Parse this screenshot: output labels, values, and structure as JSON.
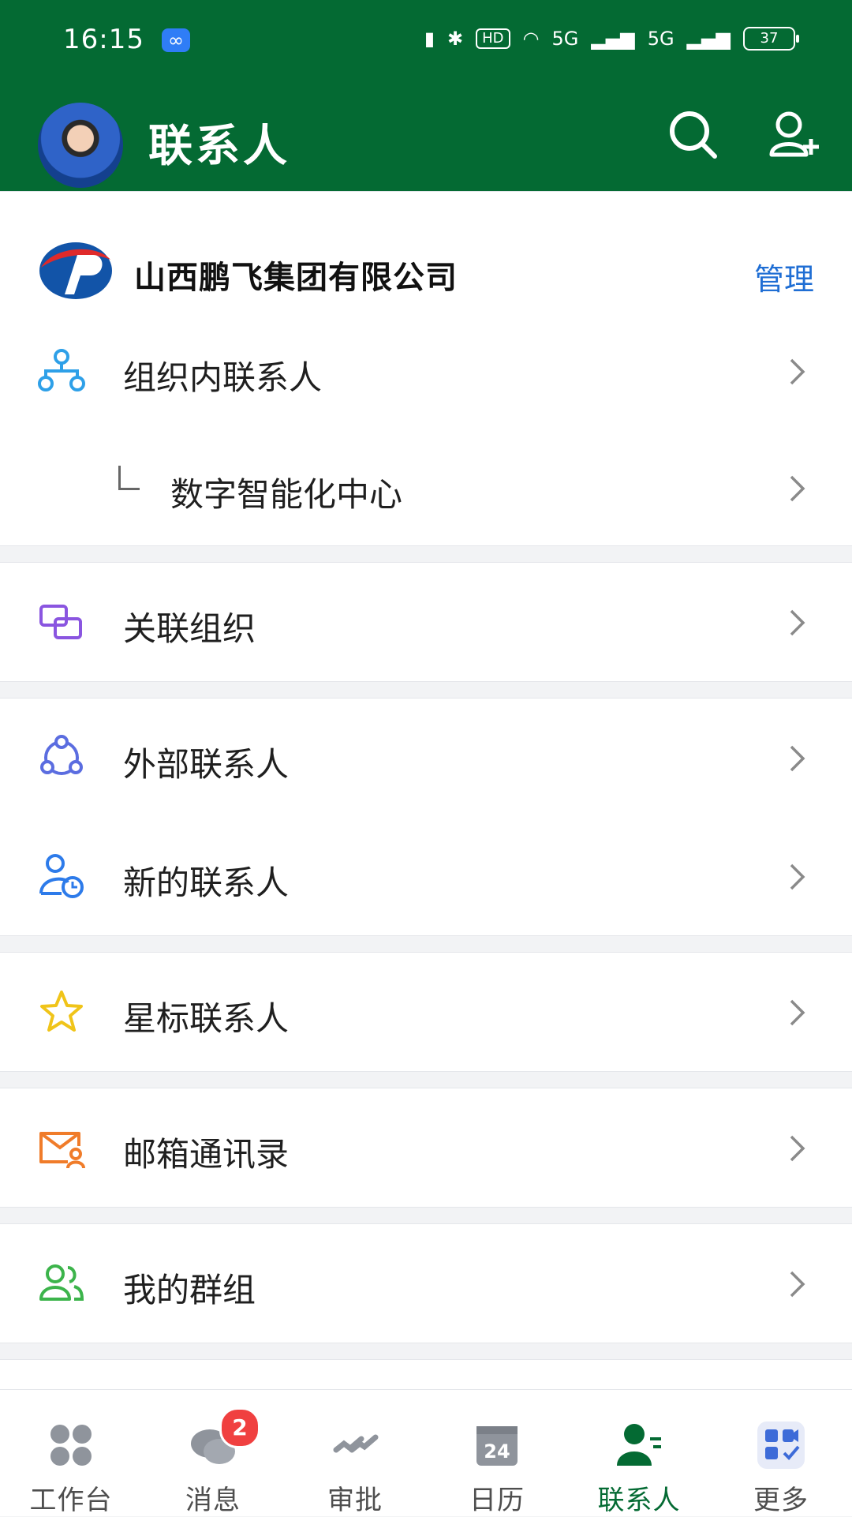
{
  "status_bar": {
    "time": "16:15",
    "hd_label": "HD",
    "network_1": "5G",
    "network_2": "5G",
    "battery": "37"
  },
  "header": {
    "title": "联系人"
  },
  "company": {
    "name": "山西鹏飞集团有限公司",
    "manage_label": "管理"
  },
  "rows": [
    {
      "label": "组织内联系人"
    },
    {
      "label": "数字智能化中心"
    },
    {
      "label": "关联组织"
    },
    {
      "label": "外部联系人"
    },
    {
      "label": "新的联系人"
    },
    {
      "label": "星标联系人"
    },
    {
      "label": "邮箱通讯录"
    },
    {
      "label": "我的群组"
    }
  ],
  "tabs": [
    {
      "label": "工作台"
    },
    {
      "label": "消息",
      "badge": "2"
    },
    {
      "label": "审批"
    },
    {
      "label": "日历",
      "day": "24"
    },
    {
      "label": "联系人"
    },
    {
      "label": "更多"
    }
  ],
  "colors": {
    "header": "#046a33",
    "accent_blue": "#1f6ed4",
    "badge_red": "#f04040"
  }
}
